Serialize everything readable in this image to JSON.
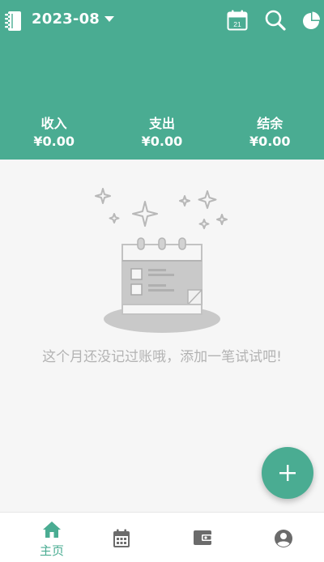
{
  "header": {
    "month": "2023-08",
    "calendar_day": "21",
    "summary": [
      {
        "label": "收入",
        "value": "¥0.00"
      },
      {
        "label": "支出",
        "value": "¥0.00"
      },
      {
        "label": "结余",
        "value": "¥0.00"
      }
    ]
  },
  "empty_state": {
    "message": "这个月还没记过账哦，添加一笔试试吧!"
  },
  "bottom_nav": {
    "home_label": "主页"
  },
  "colors": {
    "primary": "#4aac92",
    "empty_text": "#b3b3b3",
    "nav_icon": "#6b6b6b"
  },
  "icons": [
    "notebook-icon",
    "caret-down-icon",
    "calendar-icon",
    "search-icon",
    "pie-chart-icon",
    "plus-icon",
    "home-icon",
    "calendar-nav-icon",
    "wallet-icon",
    "account-icon"
  ]
}
